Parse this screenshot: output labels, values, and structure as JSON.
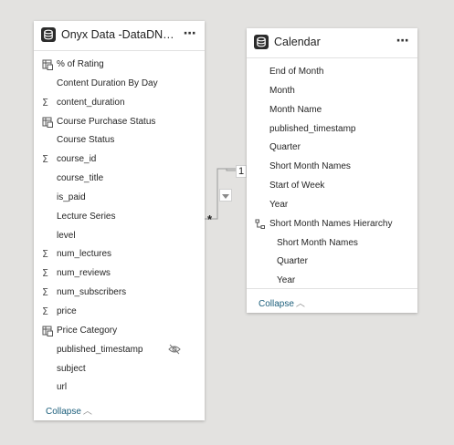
{
  "onyx_table": {
    "title": "Onyx Data -DataDNA D...",
    "more_icon": "⋯",
    "fields": [
      {
        "label": "% of Rating",
        "icon": "calc-table-icon"
      },
      {
        "label": "Content Duration By Day",
        "icon": ""
      },
      {
        "label": "content_duration",
        "icon": "sigma-icon"
      },
      {
        "label": "Course Purchase Status",
        "icon": "calc-table-icon"
      },
      {
        "label": "Course Status",
        "icon": ""
      },
      {
        "label": "course_id",
        "icon": "sigma-icon"
      },
      {
        "label": "course_title",
        "icon": ""
      },
      {
        "label": "is_paid",
        "icon": ""
      },
      {
        "label": "Lecture Series",
        "icon": ""
      },
      {
        "label": "level",
        "icon": ""
      },
      {
        "label": "num_lectures",
        "icon": "sigma-icon"
      },
      {
        "label": "num_reviews",
        "icon": "sigma-icon"
      },
      {
        "label": "num_subscribers",
        "icon": "sigma-icon"
      },
      {
        "label": "price",
        "icon": "sigma-icon"
      },
      {
        "label": "Price Category",
        "icon": "calc-table-icon"
      },
      {
        "label": "published_timestamp",
        "icon": "",
        "hidden": true
      },
      {
        "label": "subject",
        "icon": ""
      },
      {
        "label": "url",
        "icon": ""
      }
    ],
    "collapse_label": "Collapse"
  },
  "calendar_table": {
    "title": "Calendar",
    "more_icon": "⋯",
    "fields": [
      {
        "label": "End of Month",
        "icon": ""
      },
      {
        "label": "Month",
        "icon": ""
      },
      {
        "label": "Month Name",
        "icon": ""
      },
      {
        "label": "published_timestamp",
        "icon": ""
      },
      {
        "label": "Quarter",
        "icon": ""
      },
      {
        "label": "Short Month Names",
        "icon": ""
      },
      {
        "label": "Start of Week",
        "icon": ""
      },
      {
        "label": "Year",
        "icon": ""
      },
      {
        "label": "Short Month Names Hierarchy",
        "icon": "hierarchy-icon"
      },
      {
        "label": "Short Month Names",
        "icon": "",
        "child": true
      },
      {
        "label": "Quarter",
        "icon": "",
        "child": true
      },
      {
        "label": "Year",
        "icon": "",
        "child": true
      }
    ],
    "collapse_label": "Collapse"
  },
  "relationship": {
    "one_side": "1",
    "many_side": "*",
    "direction": "single"
  },
  "colors": {
    "canvas": "#e3e2e0",
    "link": "#1b5e7b",
    "text": "#252525"
  }
}
